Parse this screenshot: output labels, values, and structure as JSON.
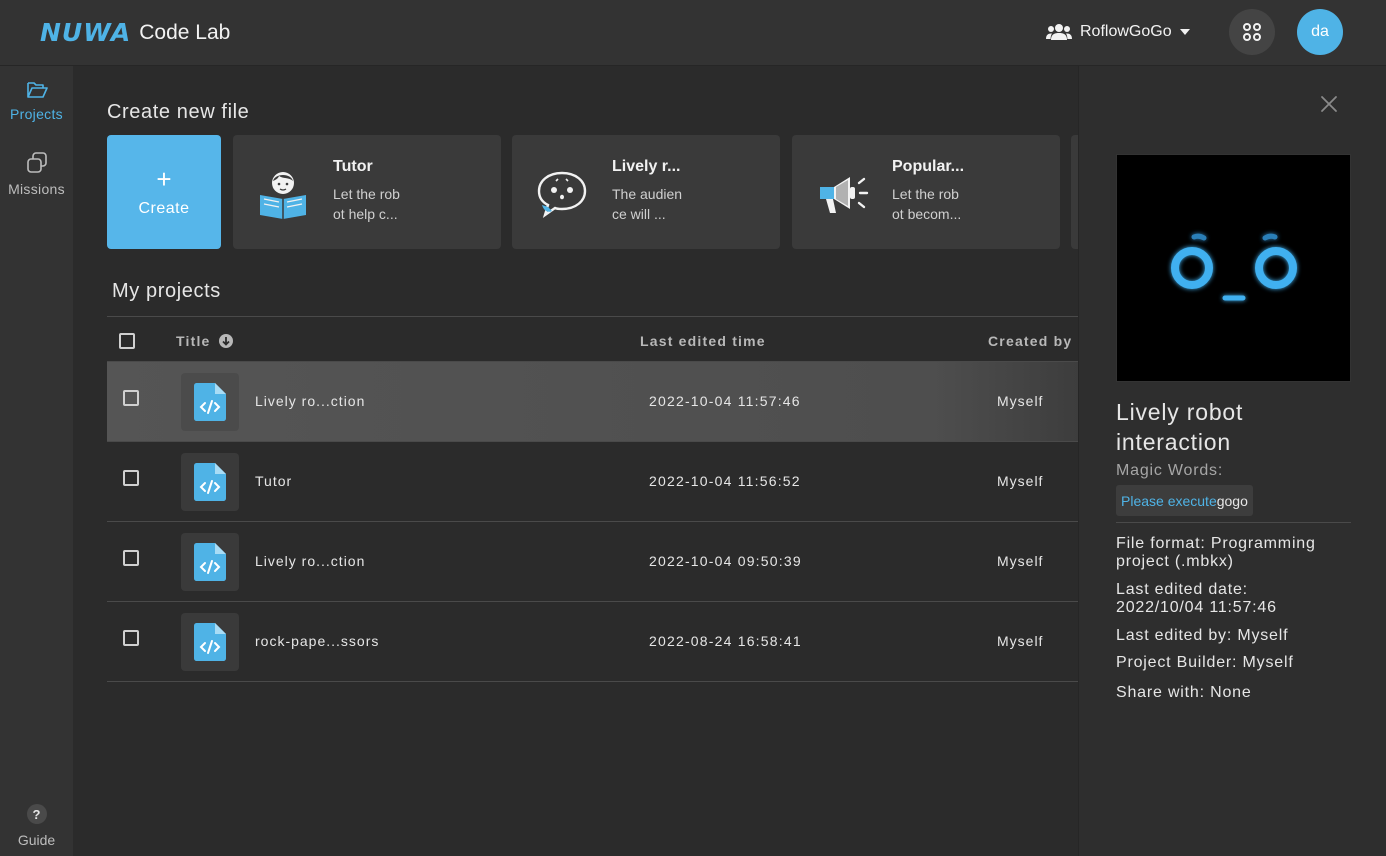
{
  "app": {
    "logo_mark": "NUWA",
    "title": "Code Lab"
  },
  "header": {
    "org_name": "RoflowGoGo",
    "avatar_initials": "da"
  },
  "sidebar": {
    "items": [
      {
        "label": "Projects",
        "icon": "folder-open-icon",
        "active": true
      },
      {
        "label": "Missions",
        "icon": "missions-icon",
        "active": false
      }
    ],
    "guide": {
      "symbol": "?",
      "label": "Guide"
    }
  },
  "create_section": {
    "title": "Create new file",
    "create_plus": "+",
    "create_label": "Create",
    "templates": [
      {
        "title": "Tutor",
        "desc_line1": "Let the rob",
        "desc_line2": "ot help c...",
        "icon": "reading-child-icon"
      },
      {
        "title": "Lively r...",
        "desc_line1": "The audien",
        "desc_line2": "ce will ...",
        "icon": "chat-bubble-face-icon"
      },
      {
        "title": "Popular...",
        "desc_line1": "Let the rob",
        "desc_line2": "ot becom...",
        "icon": "megaphone-icon"
      }
    ]
  },
  "projects": {
    "title": "My projects",
    "columns": {
      "title": "Title",
      "last_edited": "Last edited time",
      "created_by": "Created by"
    },
    "rows": [
      {
        "title": "Lively ro...ction",
        "time": "2022-10-04 11:57:46",
        "owner": "Myself",
        "selected": true
      },
      {
        "title": "Tutor",
        "time": "2022-10-04 11:56:52",
        "owner": "Myself",
        "selected": false
      },
      {
        "title": "Lively ro...ction",
        "time": "2022-10-04 09:50:39",
        "owner": "Myself",
        "selected": false
      },
      {
        "title": "rock-pape...ssors",
        "time": "2022-08-24 16:58:41",
        "owner": "Myself",
        "selected": false
      }
    ]
  },
  "detail": {
    "title_line1": "Lively robot",
    "title_line2": "interaction",
    "magic_label": "Magic Words:",
    "magic_prefix": "Please execute",
    "magic_word": "gogo",
    "file_format_line1": "File format: Programming",
    "file_format_line2": "project (.mbkx)",
    "last_edited_date_line1": "Last edited date:",
    "last_edited_date_line2": "2022/10/04 11:57:46",
    "last_edited_by": "Last edited by: Myself",
    "project_builder": "Project Builder: Myself",
    "share_with": "Share with: None"
  },
  "colors": {
    "accent": "#4fb3e6",
    "create_tile": "#56b6ea",
    "background": "#2b2b2b"
  }
}
